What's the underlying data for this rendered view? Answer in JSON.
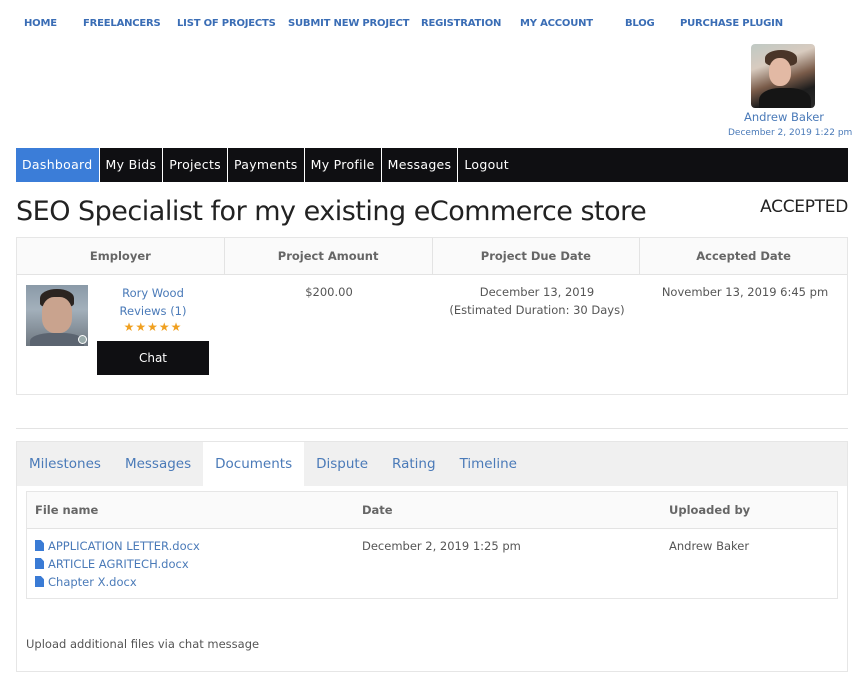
{
  "top_nav": [
    {
      "label": "HOME"
    },
    {
      "label": "FREELANCERS"
    },
    {
      "label": "LIST OF PROJECTS"
    },
    {
      "label": "SUBMIT NEW PROJECT"
    },
    {
      "label": "REGISTRATION"
    },
    {
      "label": "MY ACCOUNT"
    },
    {
      "label": "BLOG"
    },
    {
      "label": "PURCHASE PLUGIN"
    }
  ],
  "user": {
    "name": "Andrew Baker",
    "datetime": "December 2, 2019 1:22 pm"
  },
  "dash_nav": [
    {
      "label": "Dashboard",
      "active": true
    },
    {
      "label": "My Bids"
    },
    {
      "label": "Projects"
    },
    {
      "label": "Payments"
    },
    {
      "label": "My Profile"
    },
    {
      "label": "Messages"
    },
    {
      "label": "Logout"
    }
  ],
  "project": {
    "title": "SEO Specialist for my existing eCommerce store",
    "status": "ACCEPTED",
    "columns": [
      "Employer",
      "Project Amount",
      "Project Due Date",
      "Accepted Date"
    ],
    "employer": {
      "name": "Rory Wood",
      "reviews": "Reviews (1)",
      "stars": "★★★★★",
      "rating": 5,
      "chat_label": "Chat"
    },
    "amount": "$200.00",
    "due_date": "December 13, 2019",
    "estimated_duration": "(Estimated Duration: 30 Days)",
    "accepted_date": "November 13, 2019 6:45 pm"
  },
  "tabs": [
    {
      "label": "Milestones"
    },
    {
      "label": "Messages"
    },
    {
      "label": "Documents",
      "active": true
    },
    {
      "label": "Dispute"
    },
    {
      "label": "Rating"
    },
    {
      "label": "Timeline"
    }
  ],
  "documents": {
    "columns": [
      "File name",
      "Date",
      "Uploaded by"
    ],
    "files": [
      {
        "name": "APPLICATION LETTER.docx"
      },
      {
        "name": "ARTICLE AGRITECH.docx"
      },
      {
        "name": "Chapter X.docx"
      }
    ],
    "date": "December 2, 2019 1:25 pm",
    "uploaded_by": "Andrew Baker",
    "note": "Upload additional files via chat message"
  },
  "colors": {
    "link": "#3a6db5",
    "active_nav": "#3b7dd8",
    "nav_bg": "#0f0f12",
    "stars": "#f0a020"
  }
}
